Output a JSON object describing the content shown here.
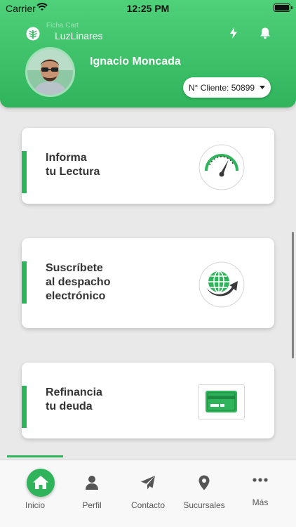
{
  "status_bar": {
    "carrier": "Carrier",
    "time": "12:25 PM"
  },
  "app": {
    "name": "LuzLinares",
    "ghost_text": "Ficha Cart"
  },
  "user": {
    "name": "Ignacio Moncada"
  },
  "client_selector": {
    "label": "N° Cliente: 50899"
  },
  "cards": [
    {
      "lines": [
        "Informa",
        "tu Lectura"
      ],
      "icon": "speedometer-icon"
    },
    {
      "lines": [
        "Suscríbete",
        "al despacho",
        "electrónico"
      ],
      "icon": "globe-arrow-icon"
    },
    {
      "lines": [
        "Refinancia",
        "tu deuda"
      ],
      "icon": "credit-card-icon"
    }
  ],
  "tabs": [
    {
      "label": "Inicio",
      "icon": "home-icon",
      "active": true
    },
    {
      "label": "Perfil",
      "icon": "person-icon"
    },
    {
      "label": "Contacto",
      "icon": "paper-plane-icon"
    },
    {
      "label": "Sucursales",
      "icon": "location-pin-icon"
    },
    {
      "label": "Más",
      "icon": "more-dots-icon"
    }
  ],
  "colors": {
    "accent": "#2fb35b",
    "header_top": "#4fd17a",
    "text_dark": "#333333"
  }
}
